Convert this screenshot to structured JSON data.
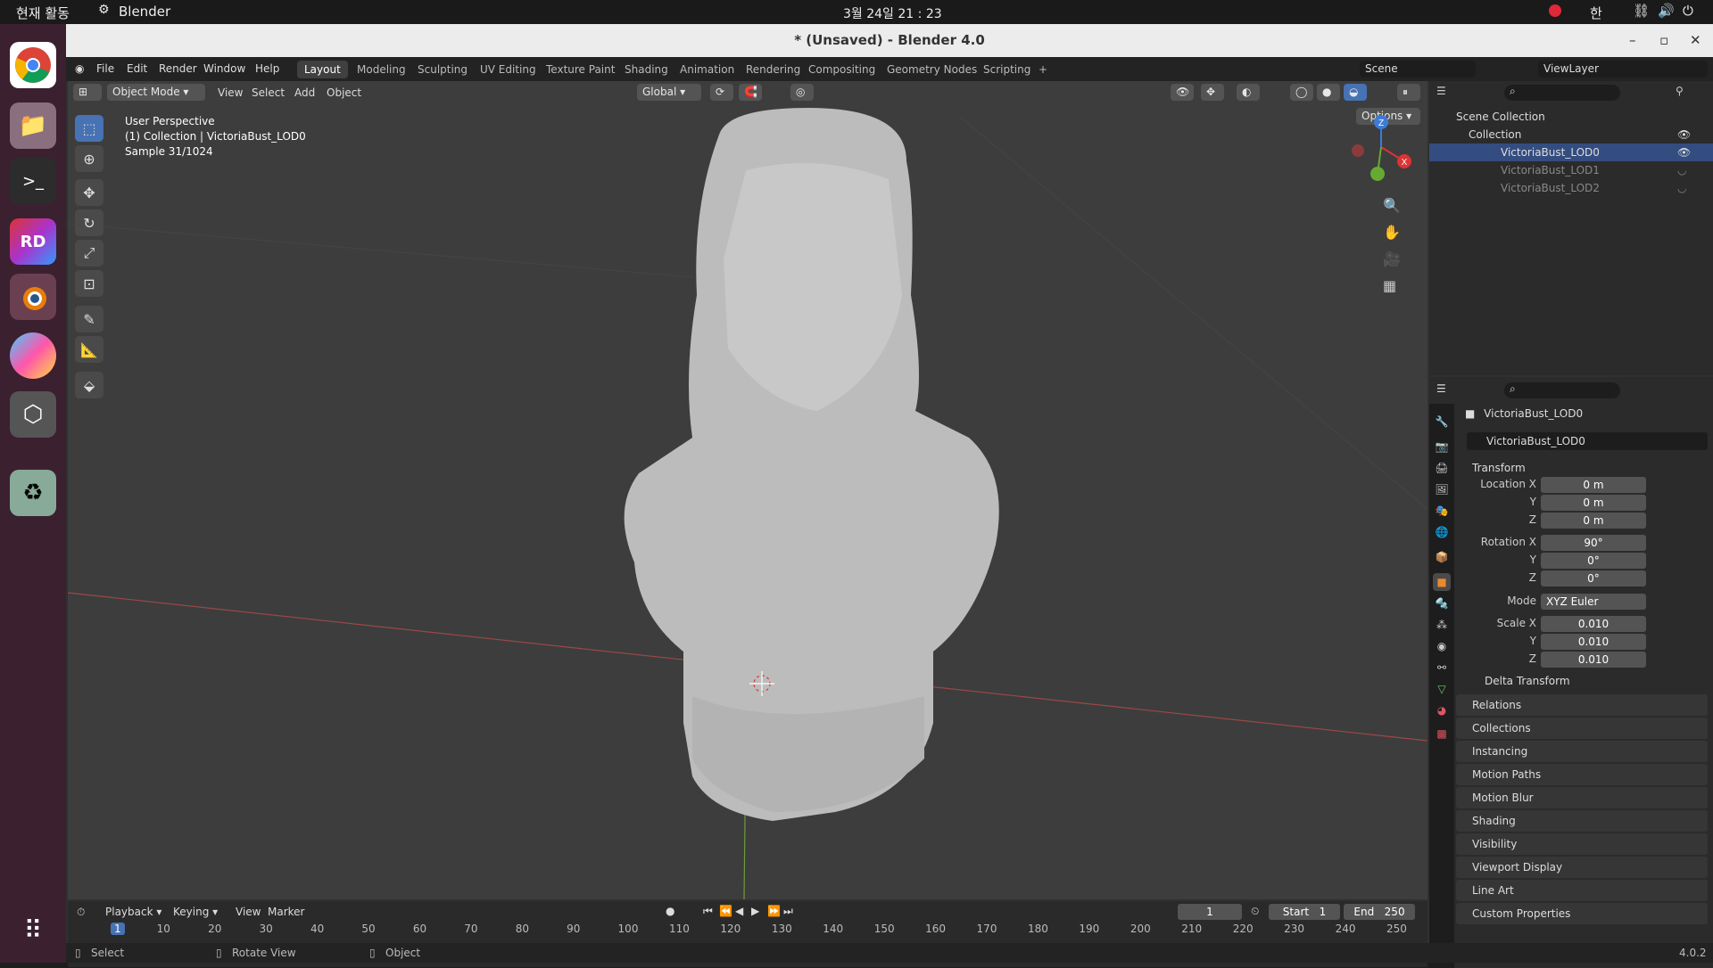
{
  "system": {
    "activities": "현재 활동",
    "app_name": "Blender",
    "clock": "3월 24일  21 : 23",
    "input_method": "한"
  },
  "window": {
    "title": "* (Unsaved) - Blender 4.0"
  },
  "menu": [
    "File",
    "Edit",
    "Render",
    "Window",
    "Help"
  ],
  "workspaces": [
    "Layout",
    "Modeling",
    "Sculpting",
    "UV Editing",
    "Texture Paint",
    "Shading",
    "Animation",
    "Rendering",
    "Compositing",
    "Geometry Nodes",
    "Scripting",
    "+"
  ],
  "scene_label": "Scene",
  "viewlayer_label": "ViewLayer",
  "viewport": {
    "mode": "Object Mode",
    "menus": [
      "View",
      "Select",
      "Add",
      "Object"
    ],
    "orientation": "Global",
    "options": "Options",
    "overlay": [
      "User Perspective",
      "(1) Collection | VictoriaBust_LOD0",
      "Sample 31/1024"
    ],
    "gizmo": {
      "x": "X",
      "y": "Y",
      "z": "Z"
    }
  },
  "outliner": {
    "scene_collection": "Scene Collection",
    "collection": "Collection",
    "objects": [
      "VictoriaBust_LOD0",
      "VictoriaBust_LOD1",
      "VictoriaBust_LOD2"
    ]
  },
  "properties": {
    "object_name": "VictoriaBust_LOD0",
    "data_name": "VictoriaBust_LOD0",
    "transform_title": "Transform",
    "location_label": "Location X",
    "location": [
      "0 m",
      "0 m",
      "0 m"
    ],
    "rotation_label": "Rotation X",
    "rotation": [
      "90°",
      "0°",
      "0°"
    ],
    "mode_label": "Mode",
    "mode": "XYZ Euler",
    "scale_label": "Scale X",
    "scale": [
      "0.010",
      "0.010",
      "0.010"
    ],
    "axis_y": "Y",
    "axis_z": "Z",
    "delta": "Delta Transform",
    "panels": [
      "Relations",
      "Collections",
      "Instancing",
      "Motion Paths",
      "Motion Blur",
      "Shading",
      "Visibility",
      "Viewport Display",
      "Line Art",
      "Custom Properties"
    ]
  },
  "timeline": {
    "menus": [
      "Playback",
      "Keying",
      "View",
      "Marker"
    ],
    "current_frame": "1",
    "start_label": "Start",
    "start": "1",
    "end_label": "End",
    "end": "250",
    "ticks": [
      "1",
      "10",
      "20",
      "30",
      "40",
      "50",
      "60",
      "70",
      "80",
      "90",
      "100",
      "110",
      "120",
      "130",
      "140",
      "150",
      "160",
      "170",
      "180",
      "190",
      "200",
      "210",
      "220",
      "230",
      "240",
      "250"
    ]
  },
  "status": {
    "select": "Select",
    "rotate": "Rotate View",
    "object": "Object",
    "version": "4.0.2"
  }
}
